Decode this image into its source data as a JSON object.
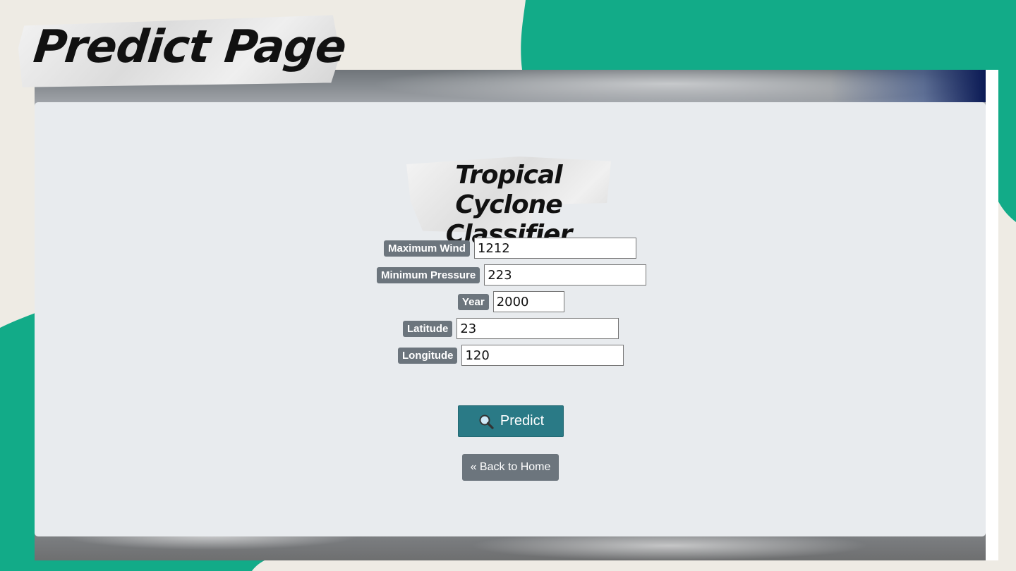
{
  "header": {
    "title": "Predict Page"
  },
  "logo": {
    "line1": "Tropical Cyclone",
    "line2": "Classifier"
  },
  "form": {
    "fields": [
      {
        "label": "Maximum Wind",
        "value": "1212"
      },
      {
        "label": "Minimum Pressure",
        "value": "223"
      },
      {
        "label": "Year",
        "value": "2000"
      },
      {
        "label": "Latitude",
        "value": "23"
      },
      {
        "label": "Longitude",
        "value": "120"
      }
    ],
    "predict_label": "Predict",
    "predict_icon": "magnifier-icon",
    "back_label": "« Back to Home"
  },
  "colors": {
    "accent_green": "#12ab88",
    "predict_button": "#2a7a86",
    "badge_gray": "#6c757d",
    "card_background": "#e8ebee",
    "page_background": "#eeebe4"
  }
}
